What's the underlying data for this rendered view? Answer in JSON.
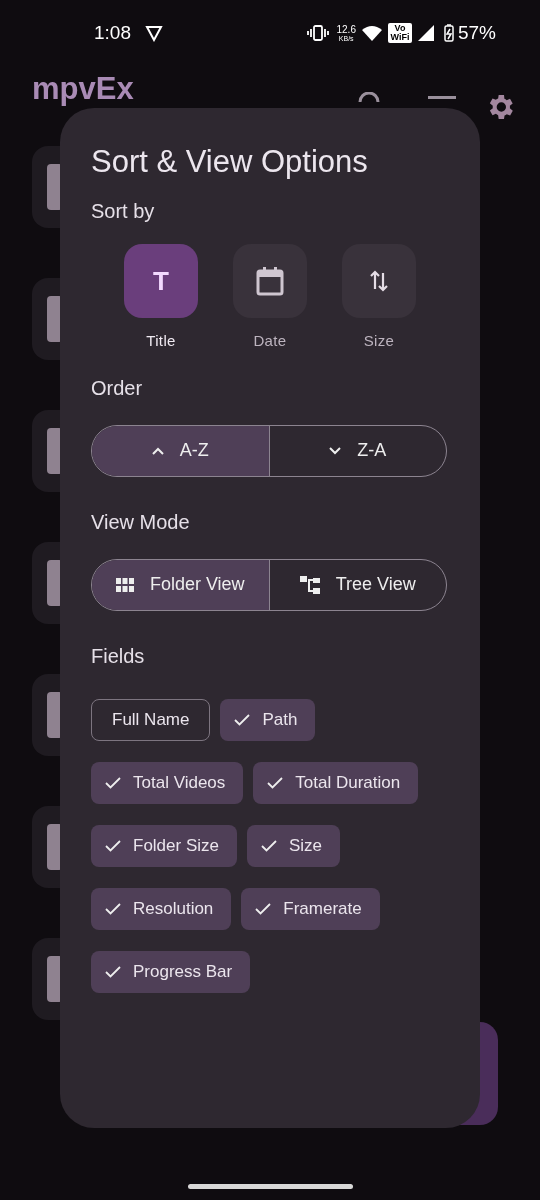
{
  "status_bar": {
    "time": "1:08",
    "speed_value": "12.6",
    "speed_unit": "KB/s",
    "vowifi": "Vo WiFi",
    "battery": "57%"
  },
  "app_bar": {
    "title": "mpvEx"
  },
  "dialog": {
    "title": "Sort & View Options",
    "sort_by": {
      "label": "Sort by",
      "options": [
        {
          "kind": "letter",
          "glyph": "T",
          "label": "Title",
          "selected": true
        },
        {
          "kind": "calendar",
          "label": "Date",
          "selected": false
        },
        {
          "kind": "arrows",
          "label": "Size",
          "selected": false
        }
      ]
    },
    "order": {
      "label": "Order",
      "options": [
        {
          "kind": "up",
          "label": "A-Z",
          "selected": true
        },
        {
          "kind": "down",
          "label": "Z-A",
          "selected": false
        }
      ]
    },
    "view_mode": {
      "label": "View Mode",
      "options": [
        {
          "kind": "grid",
          "label": "Folder View",
          "selected": true
        },
        {
          "kind": "tree",
          "label": "Tree View",
          "selected": false
        }
      ]
    },
    "fields": {
      "label": "Fields",
      "chips": [
        {
          "label": "Full Name",
          "checked": false
        },
        {
          "label": "Path",
          "checked": true
        },
        {
          "label": "Total Videos",
          "checked": true
        },
        {
          "label": "Total Duration",
          "checked": true
        },
        {
          "label": "Folder Size",
          "checked": true
        },
        {
          "label": "Size",
          "checked": true
        },
        {
          "label": "Resolution",
          "checked": true
        },
        {
          "label": "Framerate",
          "checked": true
        },
        {
          "label": "Progress Bar",
          "checked": true
        }
      ]
    }
  }
}
